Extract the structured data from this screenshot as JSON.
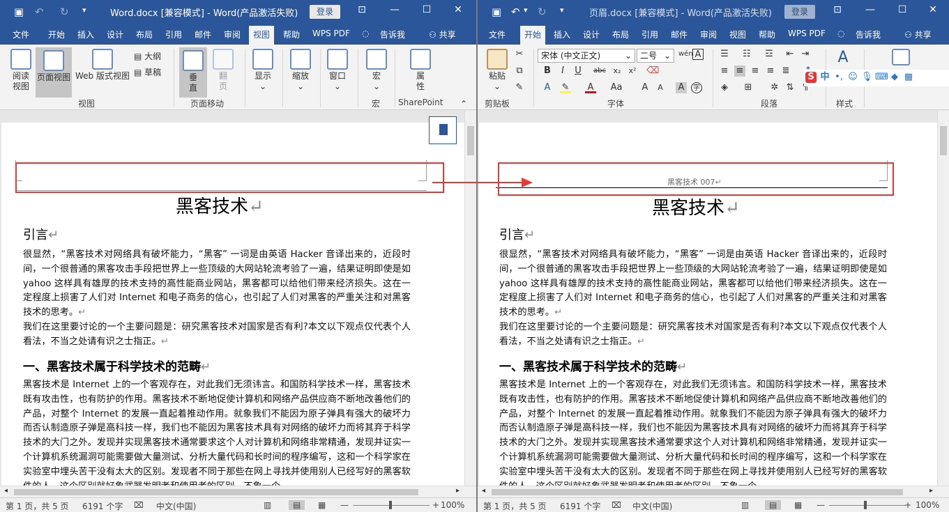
{
  "left": {
    "title": "Word.docx [兼容模式]  -  Word(产品激活失败)",
    "login": "登录",
    "tabs": [
      "文件",
      "开始",
      "插入",
      "设计",
      "布局",
      "引用",
      "邮件",
      "审阅",
      "视图",
      "帮助",
      "WPS PDF",
      "告诉我",
      "共享"
    ],
    "active_tab": "视图",
    "ribbon": {
      "read_mode": "阅读\n视图",
      "print_layout": "页面视图",
      "web_layout": "Web 版式视图",
      "outline": "大纲",
      "draft": "草稿",
      "vertical": "垂\n直",
      "side_to_side": "翻\n页",
      "show": "显示",
      "zoom": "缩放",
      "window": "窗口",
      "macros": "宏",
      "properties": "属\n性",
      "group_views": "视图",
      "group_page_movement": "页面移动",
      "group_macros": "宏",
      "group_sharepoint": "SharePoint"
    },
    "status": {
      "page": "第 1 页，共 5 页",
      "words": "6191 个字",
      "lang": "中文(中国)",
      "zoom": "100%"
    }
  },
  "right": {
    "title": "页眉.docx [兼容模式]  -  Word(产品激活失败)",
    "login": "登录",
    "tabs": [
      "文件",
      "开始",
      "插入",
      "设计",
      "布局",
      "引用",
      "邮件",
      "审阅",
      "视图",
      "帮助",
      "WPS PDF",
      "告诉我",
      "共享"
    ],
    "active_tab": "开始",
    "ribbon": {
      "paste": "粘贴",
      "font_name": "宋体 (中文正文)",
      "font_size": "二号",
      "styles": "样式",
      "group_clipboard": "剪贴板",
      "group_font": "字体",
      "group_paragraph": "段落",
      "group_styles": "样式",
      "ime": "中"
    },
    "header_text": "黑客技术 007",
    "status": {
      "page": "第 1 页，共 5 页",
      "words": "6191 个字",
      "lang": "中文(中国)",
      "zoom": "100%"
    }
  },
  "document": {
    "title": "黑客技术",
    "intro_heading": "引言",
    "para1": "很显然，“黑客技术对网络具有破坏能力，“黑客” 一词是由英语 Hacker 音译出来的，近段时间，一个很普通的黑客攻击手段把世界上一些顶级的大网站轮流考验了一遍，结果证明即使是如 yahoo 这样具有雄厚的技术支持的高性能商业网站，黑客都可以给他们带来经济损失。这在一定程度上损害了人们对 Internet 和电子商务的信心，也引起了人们对黑客的严重关注和对黑客技术的思考。",
    "para2": "我们在这里要讨论的一个主要问题是：研究黑客技术对国家是否有利?本文以下观点仅代表个人看法，不当之处请有识之士指正。",
    "section_heading": "一、黑客技术属于科学技术的范畴",
    "para3": "黑客技术是 Internet 上的一个客观存在，对此我们无须讳言。和国防科学技术一样，黑客技术既有攻击性，也有防护的作用。黑客技术不断地促使计算机和网络产品供应商不断地改善他们的产品，对整个 Internet 的发展一直起着推动作用。就象我们不能因为原子弹具有强大的破坏力而否认制造原子弹是高科技一样，我们也不能因为黑客技术具有对网络的破坏力而将其弃于科学技术的大门之外。发现并实现黑客技术通常要求这个人对计算机和网络非常精通，发现并证实一个计算机系统漏洞可能需要做大量测试、分析大量代码和长时间的程序编写，这和一个科学家在实验室中埋头苦干没有太大的区别。发现者不同于那些在网上寻找并使用别人已经写好的黑客软件的人，这个区别就好象武器发明者和使用者的区别，不象一个"
  }
}
